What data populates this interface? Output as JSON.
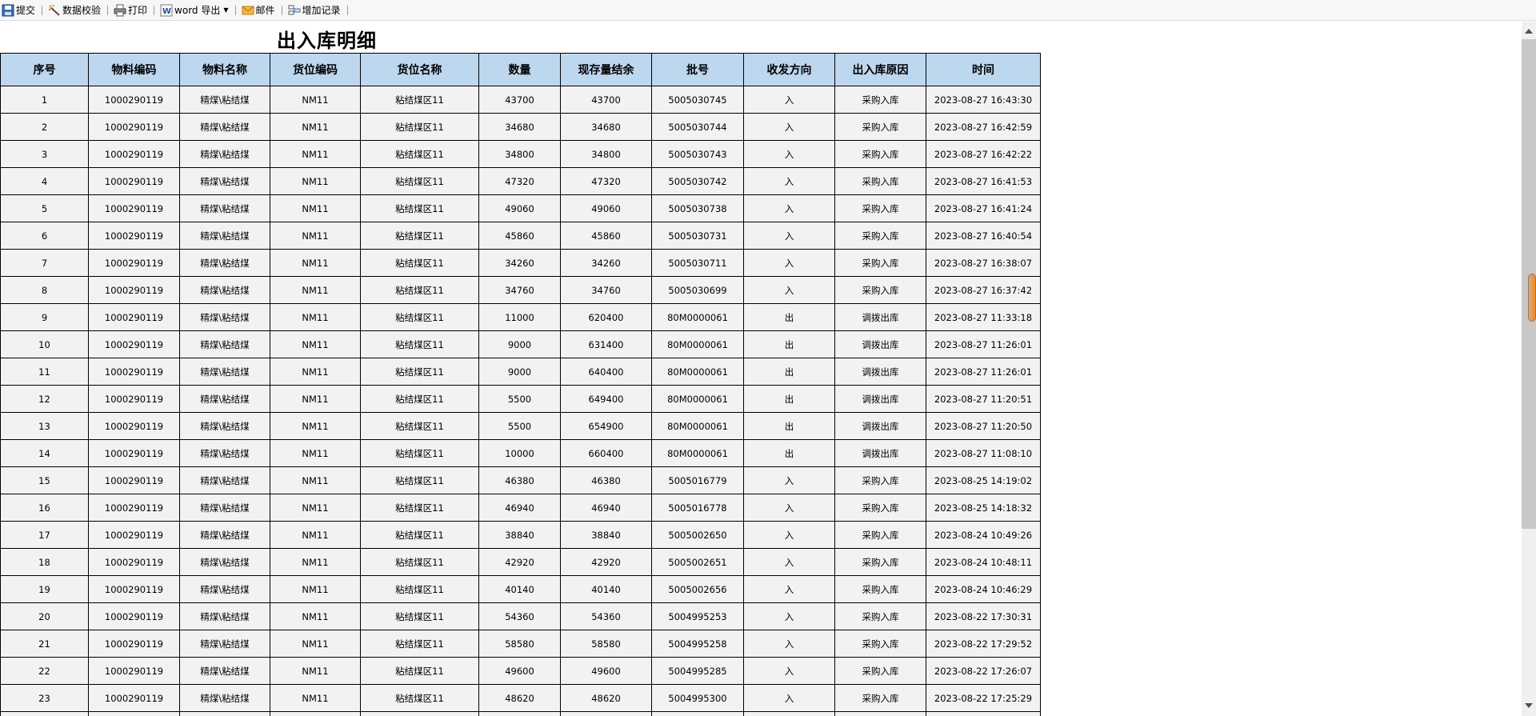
{
  "toolbar": {
    "submit": "提交",
    "validate": "数据校验",
    "print": "打印",
    "word_export": "word 导出",
    "mail": "邮件",
    "add_record": "增加记录"
  },
  "report": {
    "title": "出入库明细"
  },
  "table": {
    "headers": [
      "序号",
      "物料编码",
      "物料名称",
      "货位编码",
      "货位名称",
      "数量",
      "现存量结余",
      "批号",
      "收发方向",
      "出入库原因",
      "时间"
    ],
    "rows": [
      [
        "1",
        "1000290119",
        "精煤\\粘结煤",
        "NM11",
        "粘结煤区11",
        "43700",
        "43700",
        "5005030745",
        "入",
        "采购入库",
        "2023-08-27 16:43:30"
      ],
      [
        "2",
        "1000290119",
        "精煤\\粘结煤",
        "NM11",
        "粘结煤区11",
        "34680",
        "34680",
        "5005030744",
        "入",
        "采购入库",
        "2023-08-27 16:42:59"
      ],
      [
        "3",
        "1000290119",
        "精煤\\粘结煤",
        "NM11",
        "粘结煤区11",
        "34800",
        "34800",
        "5005030743",
        "入",
        "采购入库",
        "2023-08-27 16:42:22"
      ],
      [
        "4",
        "1000290119",
        "精煤\\粘结煤",
        "NM11",
        "粘结煤区11",
        "47320",
        "47320",
        "5005030742",
        "入",
        "采购入库",
        "2023-08-27 16:41:53"
      ],
      [
        "5",
        "1000290119",
        "精煤\\粘结煤",
        "NM11",
        "粘结煤区11",
        "49060",
        "49060",
        "5005030738",
        "入",
        "采购入库",
        "2023-08-27 16:41:24"
      ],
      [
        "6",
        "1000290119",
        "精煤\\粘结煤",
        "NM11",
        "粘结煤区11",
        "45860",
        "45860",
        "5005030731",
        "入",
        "采购入库",
        "2023-08-27 16:40:54"
      ],
      [
        "7",
        "1000290119",
        "精煤\\粘结煤",
        "NM11",
        "粘结煤区11",
        "34260",
        "34260",
        "5005030711",
        "入",
        "采购入库",
        "2023-08-27 16:38:07"
      ],
      [
        "8",
        "1000290119",
        "精煤\\粘结煤",
        "NM11",
        "粘结煤区11",
        "34760",
        "34760",
        "5005030699",
        "入",
        "采购入库",
        "2023-08-27 16:37:42"
      ],
      [
        "9",
        "1000290119",
        "精煤\\粘结煤",
        "NM11",
        "粘结煤区11",
        "11000",
        "620400",
        "80M0000061",
        "出",
        "调拨出库",
        "2023-08-27 11:33:18"
      ],
      [
        "10",
        "1000290119",
        "精煤\\粘结煤",
        "NM11",
        "粘结煤区11",
        "9000",
        "631400",
        "80M0000061",
        "出",
        "调拨出库",
        "2023-08-27 11:26:01"
      ],
      [
        "11",
        "1000290119",
        "精煤\\粘结煤",
        "NM11",
        "粘结煤区11",
        "9000",
        "640400",
        "80M0000061",
        "出",
        "调拨出库",
        "2023-08-27 11:26:01"
      ],
      [
        "12",
        "1000290119",
        "精煤\\粘结煤",
        "NM11",
        "粘结煤区11",
        "5500",
        "649400",
        "80M0000061",
        "出",
        "调拨出库",
        "2023-08-27 11:20:51"
      ],
      [
        "13",
        "1000290119",
        "精煤\\粘结煤",
        "NM11",
        "粘结煤区11",
        "5500",
        "654900",
        "80M0000061",
        "出",
        "调拨出库",
        "2023-08-27 11:20:50"
      ],
      [
        "14",
        "1000290119",
        "精煤\\粘结煤",
        "NM11",
        "粘结煤区11",
        "10000",
        "660400",
        "80M0000061",
        "出",
        "调拨出库",
        "2023-08-27 11:08:10"
      ],
      [
        "15",
        "1000290119",
        "精煤\\粘结煤",
        "NM11",
        "粘结煤区11",
        "46380",
        "46380",
        "5005016779",
        "入",
        "采购入库",
        "2023-08-25 14:19:02"
      ],
      [
        "16",
        "1000290119",
        "精煤\\粘结煤",
        "NM11",
        "粘结煤区11",
        "46940",
        "46940",
        "5005016778",
        "入",
        "采购入库",
        "2023-08-25 14:18:32"
      ],
      [
        "17",
        "1000290119",
        "精煤\\粘结煤",
        "NM11",
        "粘结煤区11",
        "38840",
        "38840",
        "5005002650",
        "入",
        "采购入库",
        "2023-08-24 10:49:26"
      ],
      [
        "18",
        "1000290119",
        "精煤\\粘结煤",
        "NM11",
        "粘结煤区11",
        "42920",
        "42920",
        "5005002651",
        "入",
        "采购入库",
        "2023-08-24 10:48:11"
      ],
      [
        "19",
        "1000290119",
        "精煤\\粘结煤",
        "NM11",
        "粘结煤区11",
        "40140",
        "40140",
        "5005002656",
        "入",
        "采购入库",
        "2023-08-24 10:46:29"
      ],
      [
        "20",
        "1000290119",
        "精煤\\粘结煤",
        "NM11",
        "粘结煤区11",
        "54360",
        "54360",
        "5004995253",
        "入",
        "采购入库",
        "2023-08-22 17:30:31"
      ],
      [
        "21",
        "1000290119",
        "精煤\\粘结煤",
        "NM11",
        "粘结煤区11",
        "58580",
        "58580",
        "5004995258",
        "入",
        "采购入库",
        "2023-08-22 17:29:52"
      ],
      [
        "22",
        "1000290119",
        "精煤\\粘结煤",
        "NM11",
        "粘结煤区11",
        "49600",
        "49600",
        "5004995285",
        "入",
        "采购入库",
        "2023-08-22 17:26:07"
      ],
      [
        "23",
        "1000290119",
        "精煤\\粘结煤",
        "NM11",
        "粘结煤区11",
        "48620",
        "48620",
        "5004995300",
        "入",
        "采购入库",
        "2023-08-22 17:25:29"
      ],
      [
        "",
        "",
        "",
        "",
        "",
        "",
        "",
        "",
        "",
        "",
        ""
      ]
    ]
  }
}
